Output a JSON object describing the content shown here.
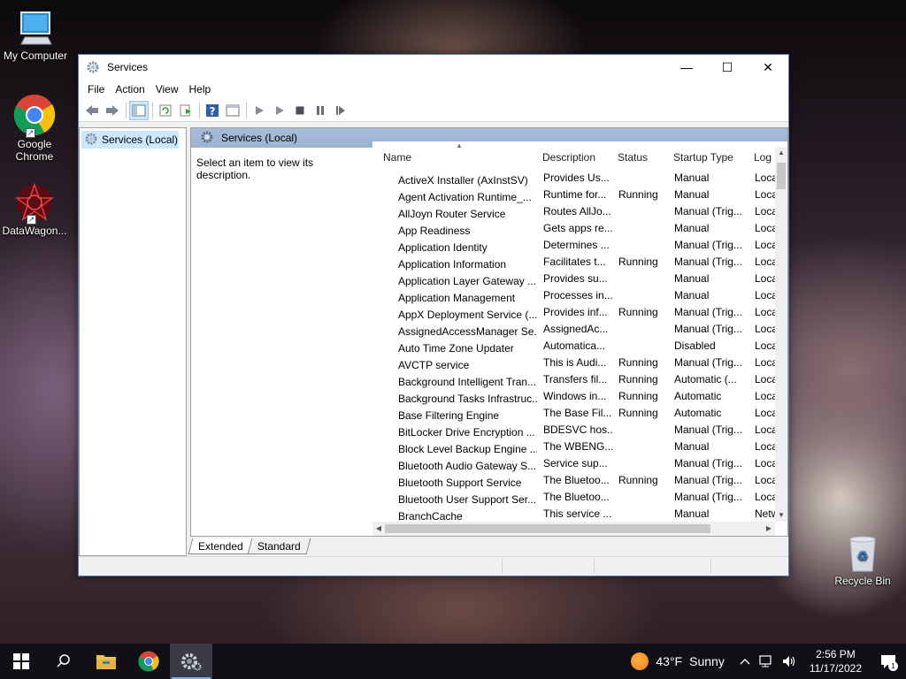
{
  "desktop": {
    "icons": [
      {
        "label": "My Computer"
      },
      {
        "label": "Google Chrome"
      },
      {
        "label": "DataWagon..."
      },
      {
        "label": "Recycle Bin"
      }
    ]
  },
  "window": {
    "title": "Services",
    "controls": {
      "minimize": "—",
      "maximize": "☐",
      "close": "✕"
    },
    "menu": [
      "File",
      "Action",
      "View",
      "Help"
    ],
    "tree": {
      "item": "Services (Local)"
    },
    "pane_title": "Services (Local)",
    "description_prompt": "Select an item to view its description.",
    "columns": {
      "name": "Name",
      "description": "Description",
      "status": "Status",
      "startup": "Startup Type",
      "logon": "Log"
    },
    "services": [
      {
        "name": "ActiveX Installer (AxInstSV)",
        "description": "Provides Us...",
        "status": "",
        "startup": "Manual",
        "logon": "Loca"
      },
      {
        "name": "Agent Activation Runtime_...",
        "description": "Runtime for...",
        "status": "Running",
        "startup": "Manual",
        "logon": "Loca"
      },
      {
        "name": "AllJoyn Router Service",
        "description": "Routes AllJo...",
        "status": "",
        "startup": "Manual (Trig...",
        "logon": "Loca"
      },
      {
        "name": "App Readiness",
        "description": "Gets apps re...",
        "status": "",
        "startup": "Manual",
        "logon": "Loca"
      },
      {
        "name": "Application Identity",
        "description": "Determines ...",
        "status": "",
        "startup": "Manual (Trig...",
        "logon": "Loca"
      },
      {
        "name": "Application Information",
        "description": "Facilitates t...",
        "status": "Running",
        "startup": "Manual (Trig...",
        "logon": "Loca"
      },
      {
        "name": "Application Layer Gateway ...",
        "description": "Provides su...",
        "status": "",
        "startup": "Manual",
        "logon": "Loca"
      },
      {
        "name": "Application Management",
        "description": "Processes in...",
        "status": "",
        "startup": "Manual",
        "logon": "Loca"
      },
      {
        "name": "AppX Deployment Service (...",
        "description": "Provides inf...",
        "status": "Running",
        "startup": "Manual (Trig...",
        "logon": "Loca"
      },
      {
        "name": "AssignedAccessManager Se...",
        "description": "AssignedAc...",
        "status": "",
        "startup": "Manual (Trig...",
        "logon": "Loca"
      },
      {
        "name": "Auto Time Zone Updater",
        "description": "Automatica...",
        "status": "",
        "startup": "Disabled",
        "logon": "Loca"
      },
      {
        "name": "AVCTP service",
        "description": "This is Audi...",
        "status": "Running",
        "startup": "Manual (Trig...",
        "logon": "Loca"
      },
      {
        "name": "Background Intelligent Tran...",
        "description": "Transfers fil...",
        "status": "Running",
        "startup": "Automatic (...",
        "logon": "Loca"
      },
      {
        "name": "Background Tasks Infrastruc...",
        "description": "Windows in...",
        "status": "Running",
        "startup": "Automatic",
        "logon": "Loca"
      },
      {
        "name": "Base Filtering Engine",
        "description": "The Base Fil...",
        "status": "Running",
        "startup": "Automatic",
        "logon": "Loca"
      },
      {
        "name": "BitLocker Drive Encryption ...",
        "description": "BDESVC hos...",
        "status": "",
        "startup": "Manual (Trig...",
        "logon": "Loca"
      },
      {
        "name": "Block Level Backup Engine ...",
        "description": "The WBENG...",
        "status": "",
        "startup": "Manual",
        "logon": "Loca"
      },
      {
        "name": "Bluetooth Audio Gateway S...",
        "description": "Service sup...",
        "status": "",
        "startup": "Manual (Trig...",
        "logon": "Loca"
      },
      {
        "name": "Bluetooth Support Service",
        "description": "The Bluetoo...",
        "status": "Running",
        "startup": "Manual (Trig...",
        "logon": "Loca"
      },
      {
        "name": "Bluetooth User Support Ser...",
        "description": "The Bluetoo...",
        "status": "",
        "startup": "Manual (Trig...",
        "logon": "Loca"
      },
      {
        "name": "BranchCache",
        "description": "This service ...",
        "status": "",
        "startup": "Manual",
        "logon": "Netw"
      }
    ],
    "tabs": [
      "Extended",
      "Standard"
    ],
    "active_tab": "Extended"
  },
  "taskbar": {
    "weather_temp": "43°F",
    "weather_text": "Sunny",
    "time": "2:56 PM",
    "date": "11/17/2022",
    "notification_count": "1"
  },
  "colors": {
    "pane_header": "#9bb2d2",
    "selection": "#cce8ff",
    "taskbar": "#101015"
  }
}
